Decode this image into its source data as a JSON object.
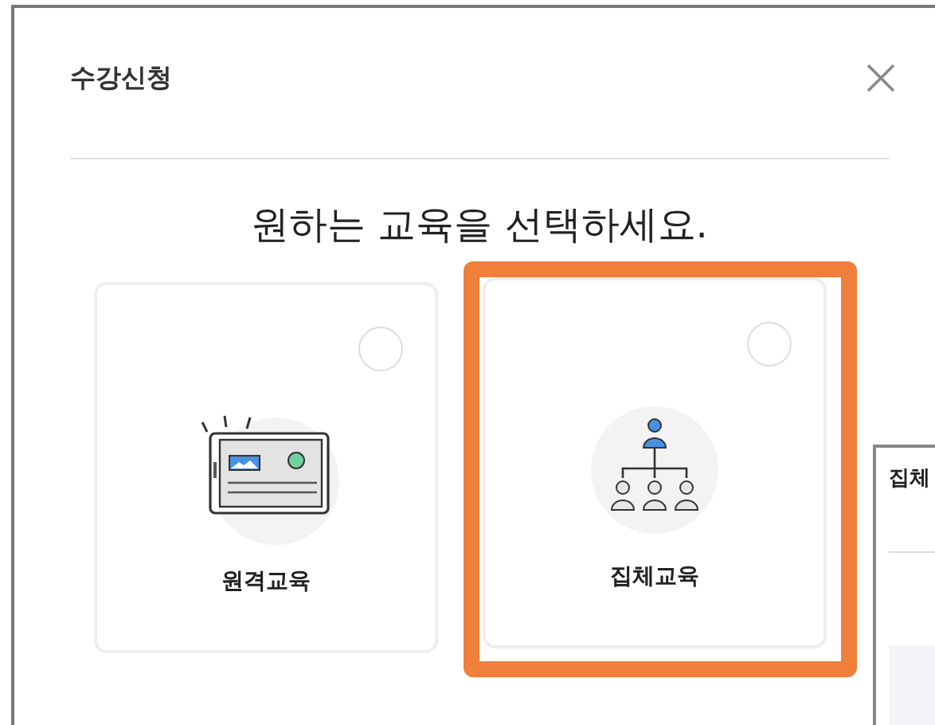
{
  "dialog": {
    "title": "수강신청",
    "heading": "원하는 교육을 선택하세요."
  },
  "options": [
    {
      "kind": "remote",
      "label": "원격교육",
      "selected": false,
      "highlighted": false
    },
    {
      "kind": "group",
      "label": "집체교육",
      "selected": false,
      "highlighted": true
    }
  ],
  "next_dialog": {
    "title": "집체"
  }
}
